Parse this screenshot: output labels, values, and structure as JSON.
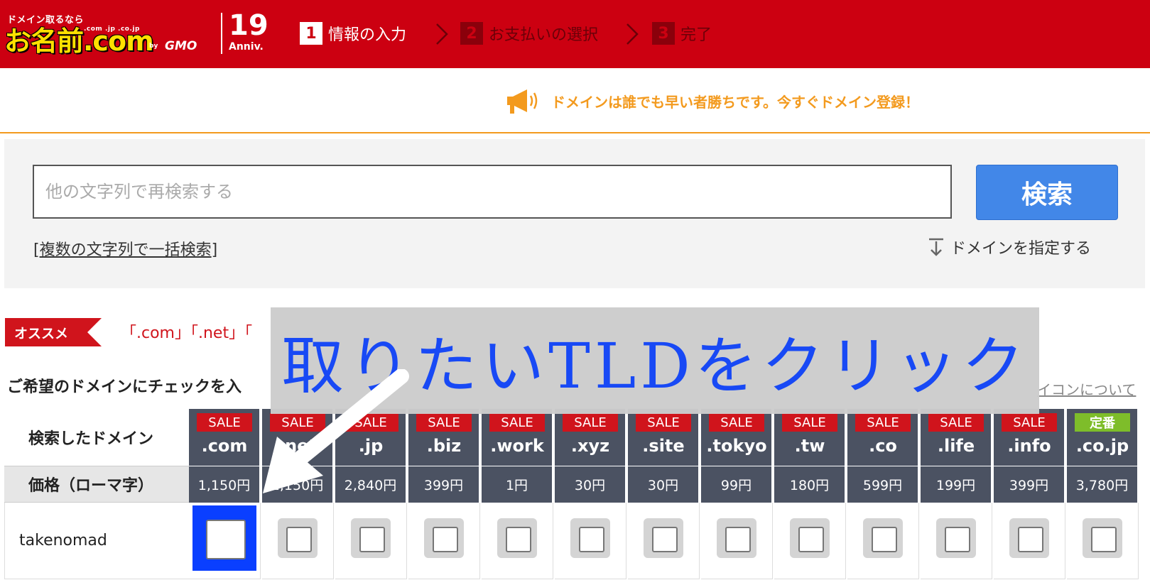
{
  "header": {
    "logo_tagline": "ドメイン取るなら",
    "logo_tlds": ".com .jp .co.jp",
    "logo_name": "お名前.com",
    "logo_by": "by",
    "logo_company": "GMO",
    "anniv_number": "19",
    "anniv_label": "Anniv.",
    "steps": [
      {
        "num": "1",
        "label": "情報の入力",
        "active": true
      },
      {
        "num": "2",
        "label": "お支払いの選択",
        "active": false
      },
      {
        "num": "3",
        "label": "完了",
        "active": false
      }
    ]
  },
  "notice": {
    "icon": "megaphone-icon",
    "text": "ドメインは誰でも早い者勝ちです。今すぐドメイン登録！"
  },
  "search": {
    "placeholder": "他の文字列で再検索する",
    "button_label": "検索",
    "bulk_open": "[",
    "bulk_link": "複数の文字列で一括検索",
    "bulk_close": "]",
    "specify_icon": "download-arrow-icon",
    "specify_label": "ドメインを指定する"
  },
  "recommend": {
    "badge": "オススメ",
    "tlds_text": "「.com」「.net」「"
  },
  "instruction": "ご希望のドメインにチェックを入",
  "icon_about": "イコンについて",
  "table": {
    "header_label": "検索したドメイン",
    "price_label": "価格（ローマ字）",
    "domain": "takenomad",
    "columns": [
      {
        "badge": "SALE",
        "badge_type": "sale",
        "tld": ".com",
        "price": "1,150円",
        "checked": false,
        "highlighted": true
      },
      {
        "badge": "SALE",
        "badge_type": "sale",
        "tld": ".net",
        "price": "1,150円",
        "checked": false,
        "highlighted": false
      },
      {
        "badge": "SALE",
        "badge_type": "sale",
        "tld": ".jp",
        "price": "2,840円",
        "checked": false,
        "highlighted": false
      },
      {
        "badge": "SALE",
        "badge_type": "sale",
        "tld": ".biz",
        "price": "399円",
        "checked": false,
        "highlighted": false
      },
      {
        "badge": "SALE",
        "badge_type": "sale",
        "tld": ".work",
        "price": "1円",
        "checked": false,
        "highlighted": false
      },
      {
        "badge": "SALE",
        "badge_type": "sale",
        "tld": ".xyz",
        "price": "30円",
        "checked": false,
        "highlighted": false
      },
      {
        "badge": "SALE",
        "badge_type": "sale",
        "tld": ".site",
        "price": "30円",
        "checked": false,
        "highlighted": false
      },
      {
        "badge": "SALE",
        "badge_type": "sale",
        "tld": ".tokyo",
        "price": "99円",
        "checked": false,
        "highlighted": false
      },
      {
        "badge": "SALE",
        "badge_type": "sale",
        "tld": ".tw",
        "price": "180円",
        "checked": false,
        "highlighted": false
      },
      {
        "badge": "SALE",
        "badge_type": "sale",
        "tld": ".co",
        "price": "599円",
        "checked": false,
        "highlighted": false
      },
      {
        "badge": "SALE",
        "badge_type": "sale",
        "tld": ".life",
        "price": "199円",
        "checked": false,
        "highlighted": false
      },
      {
        "badge": "SALE",
        "badge_type": "sale",
        "tld": ".info",
        "price": "399円",
        "checked": false,
        "highlighted": false
      },
      {
        "badge": "定番",
        "badge_type": "std",
        "tld": ".co.jp",
        "price": "3,780円",
        "checked": false,
        "highlighted": false
      }
    ]
  },
  "annotation": {
    "text": "取りたいTLDをクリック",
    "text_color": "#1849f5",
    "highlight_color": "#0a3fff"
  },
  "colors": {
    "brand_red": "#cc0011",
    "accent_orange": "#f39a1e",
    "search_blue": "#4287e8",
    "table_header": "#4b5262",
    "sale_red": "#d0141c",
    "standard_green": "#7ebd2a"
  }
}
